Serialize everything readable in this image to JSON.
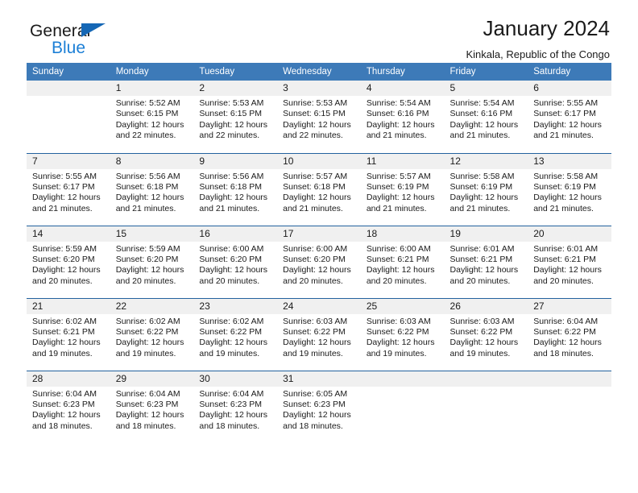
{
  "brand": {
    "word1": "General",
    "word2": "Blue",
    "triangle_color": "#1567b5",
    "word2_color": "#1c7fd6"
  },
  "header": {
    "title": "January 2024",
    "subtitle": "Kinkala, Republic of the Congo"
  },
  "colors": {
    "header_blue": "#3d7ab8",
    "row_divider_blue": "#23629f",
    "daynum_band": "#f0f0f0",
    "text": "#1a1a1a"
  },
  "weekdays": [
    "Sunday",
    "Monday",
    "Tuesday",
    "Wednesday",
    "Thursday",
    "Friday",
    "Saturday"
  ],
  "labels": {
    "sunrise": "Sunrise:",
    "sunset": "Sunset:",
    "daylight": "Daylight:"
  },
  "weeks": [
    [
      {
        "day": "",
        "sunrise": "",
        "sunset": "",
        "daylight": "",
        "empty": true
      },
      {
        "day": "1",
        "sunrise": "Sunrise: 5:52 AM",
        "sunset": "Sunset: 6:15 PM",
        "daylight": "Daylight: 12 hours and 22 minutes."
      },
      {
        "day": "2",
        "sunrise": "Sunrise: 5:53 AM",
        "sunset": "Sunset: 6:15 PM",
        "daylight": "Daylight: 12 hours and 22 minutes."
      },
      {
        "day": "3",
        "sunrise": "Sunrise: 5:53 AM",
        "sunset": "Sunset: 6:15 PM",
        "daylight": "Daylight: 12 hours and 22 minutes."
      },
      {
        "day": "4",
        "sunrise": "Sunrise: 5:54 AM",
        "sunset": "Sunset: 6:16 PM",
        "daylight": "Daylight: 12 hours and 21 minutes."
      },
      {
        "day": "5",
        "sunrise": "Sunrise: 5:54 AM",
        "sunset": "Sunset: 6:16 PM",
        "daylight": "Daylight: 12 hours and 21 minutes."
      },
      {
        "day": "6",
        "sunrise": "Sunrise: 5:55 AM",
        "sunset": "Sunset: 6:17 PM",
        "daylight": "Daylight: 12 hours and 21 minutes."
      }
    ],
    [
      {
        "day": "7",
        "sunrise": "Sunrise: 5:55 AM",
        "sunset": "Sunset: 6:17 PM",
        "daylight": "Daylight: 12 hours and 21 minutes."
      },
      {
        "day": "8",
        "sunrise": "Sunrise: 5:56 AM",
        "sunset": "Sunset: 6:18 PM",
        "daylight": "Daylight: 12 hours and 21 minutes."
      },
      {
        "day": "9",
        "sunrise": "Sunrise: 5:56 AM",
        "sunset": "Sunset: 6:18 PM",
        "daylight": "Daylight: 12 hours and 21 minutes."
      },
      {
        "day": "10",
        "sunrise": "Sunrise: 5:57 AM",
        "sunset": "Sunset: 6:18 PM",
        "daylight": "Daylight: 12 hours and 21 minutes."
      },
      {
        "day": "11",
        "sunrise": "Sunrise: 5:57 AM",
        "sunset": "Sunset: 6:19 PM",
        "daylight": "Daylight: 12 hours and 21 minutes."
      },
      {
        "day": "12",
        "sunrise": "Sunrise: 5:58 AM",
        "sunset": "Sunset: 6:19 PM",
        "daylight": "Daylight: 12 hours and 21 minutes."
      },
      {
        "day": "13",
        "sunrise": "Sunrise: 5:58 AM",
        "sunset": "Sunset: 6:19 PM",
        "daylight": "Daylight: 12 hours and 21 minutes."
      }
    ],
    [
      {
        "day": "14",
        "sunrise": "Sunrise: 5:59 AM",
        "sunset": "Sunset: 6:20 PM",
        "daylight": "Daylight: 12 hours and 20 minutes."
      },
      {
        "day": "15",
        "sunrise": "Sunrise: 5:59 AM",
        "sunset": "Sunset: 6:20 PM",
        "daylight": "Daylight: 12 hours and 20 minutes."
      },
      {
        "day": "16",
        "sunrise": "Sunrise: 6:00 AM",
        "sunset": "Sunset: 6:20 PM",
        "daylight": "Daylight: 12 hours and 20 minutes."
      },
      {
        "day": "17",
        "sunrise": "Sunrise: 6:00 AM",
        "sunset": "Sunset: 6:20 PM",
        "daylight": "Daylight: 12 hours and 20 minutes."
      },
      {
        "day": "18",
        "sunrise": "Sunrise: 6:00 AM",
        "sunset": "Sunset: 6:21 PM",
        "daylight": "Daylight: 12 hours and 20 minutes."
      },
      {
        "day": "19",
        "sunrise": "Sunrise: 6:01 AM",
        "sunset": "Sunset: 6:21 PM",
        "daylight": "Daylight: 12 hours and 20 minutes."
      },
      {
        "day": "20",
        "sunrise": "Sunrise: 6:01 AM",
        "sunset": "Sunset: 6:21 PM",
        "daylight": "Daylight: 12 hours and 20 minutes."
      }
    ],
    [
      {
        "day": "21",
        "sunrise": "Sunrise: 6:02 AM",
        "sunset": "Sunset: 6:21 PM",
        "daylight": "Daylight: 12 hours and 19 minutes."
      },
      {
        "day": "22",
        "sunrise": "Sunrise: 6:02 AM",
        "sunset": "Sunset: 6:22 PM",
        "daylight": "Daylight: 12 hours and 19 minutes."
      },
      {
        "day": "23",
        "sunrise": "Sunrise: 6:02 AM",
        "sunset": "Sunset: 6:22 PM",
        "daylight": "Daylight: 12 hours and 19 minutes."
      },
      {
        "day": "24",
        "sunrise": "Sunrise: 6:03 AM",
        "sunset": "Sunset: 6:22 PM",
        "daylight": "Daylight: 12 hours and 19 minutes."
      },
      {
        "day": "25",
        "sunrise": "Sunrise: 6:03 AM",
        "sunset": "Sunset: 6:22 PM",
        "daylight": "Daylight: 12 hours and 19 minutes."
      },
      {
        "day": "26",
        "sunrise": "Sunrise: 6:03 AM",
        "sunset": "Sunset: 6:22 PM",
        "daylight": "Daylight: 12 hours and 19 minutes."
      },
      {
        "day": "27",
        "sunrise": "Sunrise: 6:04 AM",
        "sunset": "Sunset: 6:22 PM",
        "daylight": "Daylight: 12 hours and 18 minutes."
      }
    ],
    [
      {
        "day": "28",
        "sunrise": "Sunrise: 6:04 AM",
        "sunset": "Sunset: 6:23 PM",
        "daylight": "Daylight: 12 hours and 18 minutes."
      },
      {
        "day": "29",
        "sunrise": "Sunrise: 6:04 AM",
        "sunset": "Sunset: 6:23 PM",
        "daylight": "Daylight: 12 hours and 18 minutes."
      },
      {
        "day": "30",
        "sunrise": "Sunrise: 6:04 AM",
        "sunset": "Sunset: 6:23 PM",
        "daylight": "Daylight: 12 hours and 18 minutes."
      },
      {
        "day": "31",
        "sunrise": "Sunrise: 6:05 AM",
        "sunset": "Sunset: 6:23 PM",
        "daylight": "Daylight: 12 hours and 18 minutes."
      },
      {
        "day": "",
        "sunrise": "",
        "sunset": "",
        "daylight": "",
        "empty": true
      },
      {
        "day": "",
        "sunrise": "",
        "sunset": "",
        "daylight": "",
        "empty": true
      },
      {
        "day": "",
        "sunrise": "",
        "sunset": "",
        "daylight": "",
        "empty": true
      }
    ]
  ]
}
